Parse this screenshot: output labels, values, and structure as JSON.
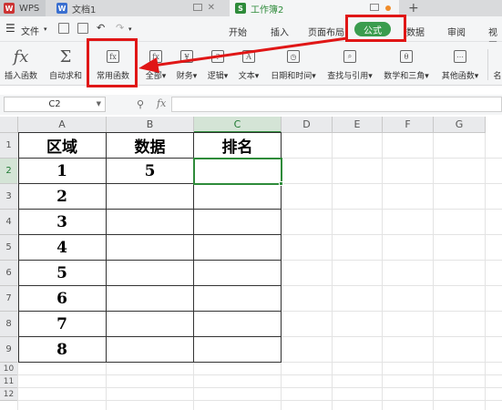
{
  "tabs": [
    {
      "label": "WPS"
    },
    {
      "label": "文档1"
    },
    {
      "label": "工作簿2"
    }
  ],
  "menu": {
    "file_label": "文件",
    "items": [
      "开始",
      "插入",
      "页面布局",
      "公式",
      "数据",
      "审阅",
      "视图"
    ],
    "active": "公式"
  },
  "ribbon": {
    "insert_function": "插入函数",
    "autosum": "自动求和",
    "common_functions": "常用函数",
    "all": "全部",
    "finance": "财务",
    "logic": "逻辑",
    "text": "文本",
    "datetime": "日期和时间",
    "lookup": "查找与引用",
    "math": "数学和三角",
    "other": "其他函数",
    "cut_off": "名"
  },
  "formula_bar": {
    "name_box": "C2",
    "fx": "fx",
    "value": ""
  },
  "columns": [
    "A",
    "B",
    "C",
    "D",
    "E",
    "F",
    "G"
  ],
  "rows": [
    "1",
    "2",
    "3",
    "4",
    "5",
    "6",
    "7",
    "8",
    "9",
    "10",
    "11",
    "12"
  ],
  "table": {
    "headers": [
      "区域",
      "数据",
      "排名"
    ],
    "rows": [
      [
        "1",
        "5",
        ""
      ],
      [
        "2",
        "",
        ""
      ],
      [
        "3",
        "",
        ""
      ],
      [
        "4",
        "",
        ""
      ],
      [
        "5",
        "",
        ""
      ],
      [
        "6",
        "",
        ""
      ],
      [
        "7",
        "",
        ""
      ],
      [
        "8",
        "",
        ""
      ]
    ]
  },
  "colors": {
    "accent_green": "#3a9c4e",
    "highlight_red": "#e01616"
  }
}
